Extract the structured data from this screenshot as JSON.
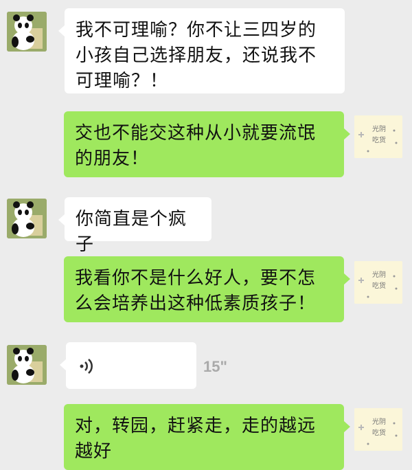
{
  "messages": [
    {
      "side": "left",
      "text": "我不可理喻？你不让三四岁的小孩自己选择朋友，还说我不可理喻？！"
    },
    {
      "side": "right",
      "text": "交也不能交这种从小就要流氓的朋友！"
    },
    {
      "side": "left",
      "text": "你简直是个疯子"
    },
    {
      "side": "right",
      "text": "我看你不是什么好人，要不怎么会培养出这种低素质孩子！"
    },
    {
      "side": "left",
      "type": "voice",
      "duration": "15\""
    },
    {
      "side": "right",
      "text": "对，转园，赶紧走，走的越远越好"
    }
  ],
  "avatars": {
    "left": {
      "icon": "panda-icon"
    },
    "right": {
      "icon": "sticky-note-icon",
      "text_a": "光阴",
      "text_b": "吃货"
    }
  },
  "colors": {
    "incoming": "#ffffff",
    "outgoing": "#9fe85e",
    "background": "#ececec"
  }
}
